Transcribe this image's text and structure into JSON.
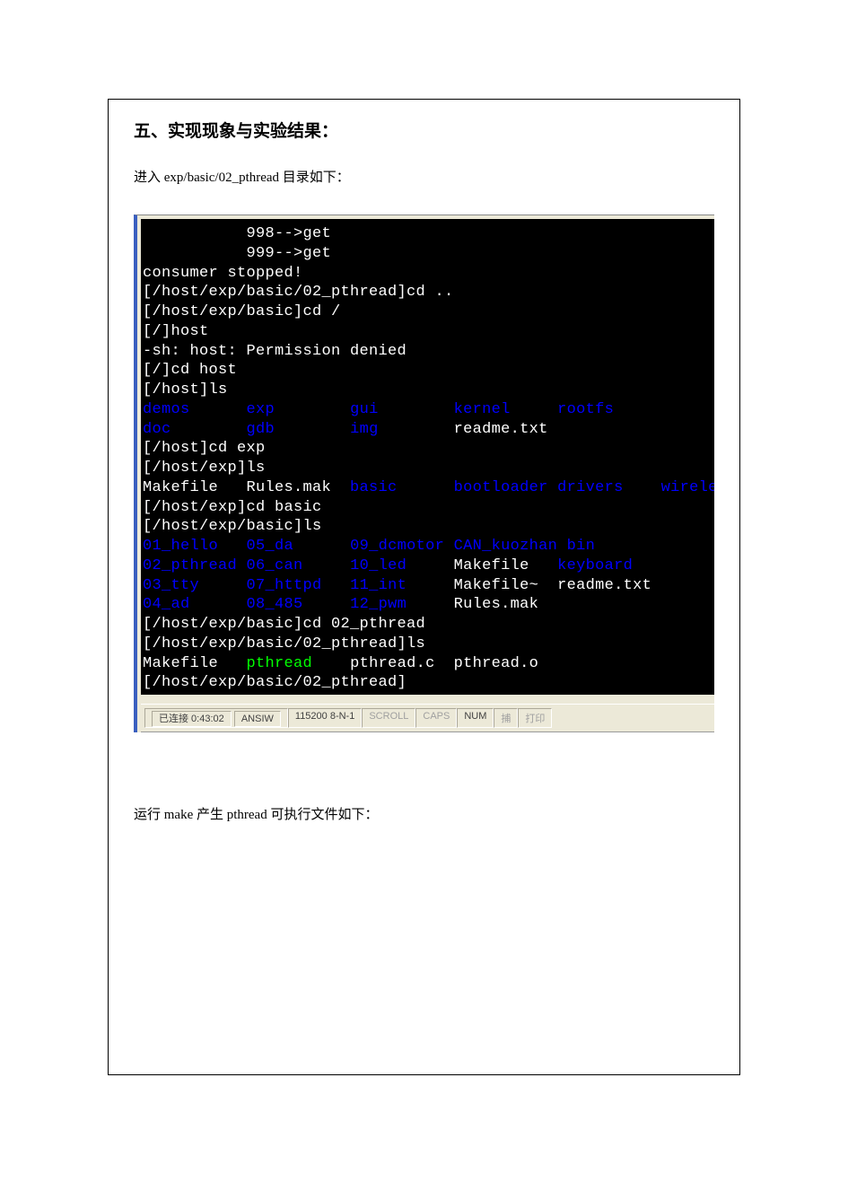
{
  "doc": {
    "heading": "五、实现现象与实验结果：",
    "intro": "进入 exp/basic/02_pthread 目录如下：",
    "post": "运行 make 产生 pthread 可执行文件如下："
  },
  "terminal": {
    "lines": [
      {
        "indent": "           ",
        "segs": [
          {
            "t": "998-->get",
            "c": "w"
          }
        ]
      },
      {
        "indent": "           ",
        "segs": [
          {
            "t": "999-->get",
            "c": "w"
          }
        ]
      },
      {
        "indent": "",
        "segs": [
          {
            "t": "consumer stopped!",
            "c": "w"
          }
        ]
      },
      {
        "indent": "",
        "segs": [
          {
            "t": "[/host/exp/basic/02_pthread]cd ..",
            "c": "w"
          }
        ]
      },
      {
        "indent": "",
        "segs": [
          {
            "t": "[/host/exp/basic]cd /",
            "c": "w"
          }
        ]
      },
      {
        "indent": "",
        "segs": [
          {
            "t": "[/]host",
            "c": "w"
          }
        ]
      },
      {
        "indent": "",
        "segs": [
          {
            "t": "-sh: host: Permission denied",
            "c": "w"
          }
        ]
      },
      {
        "indent": "",
        "segs": [
          {
            "t": "[/]cd host",
            "c": "w"
          }
        ]
      },
      {
        "indent": "",
        "segs": [
          {
            "t": "[/host]ls",
            "c": "w"
          }
        ]
      },
      {
        "indent": "",
        "segs": [
          {
            "t": "demos",
            "c": "b"
          },
          {
            "t": "      ",
            "c": "w"
          },
          {
            "t": "exp",
            "c": "b"
          },
          {
            "t": "        ",
            "c": "w"
          },
          {
            "t": "gui",
            "c": "b"
          },
          {
            "t": "        ",
            "c": "w"
          },
          {
            "t": "kernel",
            "c": "b"
          },
          {
            "t": "     ",
            "c": "w"
          },
          {
            "t": "rootfs",
            "c": "b"
          }
        ]
      },
      {
        "indent": "",
        "segs": [
          {
            "t": "doc",
            "c": "b"
          },
          {
            "t": "        ",
            "c": "w"
          },
          {
            "t": "gdb",
            "c": "b"
          },
          {
            "t": "        ",
            "c": "w"
          },
          {
            "t": "img",
            "c": "b"
          },
          {
            "t": "        ",
            "c": "w"
          },
          {
            "t": "readme.txt",
            "c": "w"
          }
        ]
      },
      {
        "indent": "",
        "segs": [
          {
            "t": "[/host]cd exp",
            "c": "w"
          }
        ]
      },
      {
        "indent": "",
        "segs": [
          {
            "t": "[/host/exp]ls",
            "c": "w"
          }
        ]
      },
      {
        "indent": "",
        "segs": [
          {
            "t": "Makefile   Rules.mak  ",
            "c": "w"
          },
          {
            "t": "basic",
            "c": "b"
          },
          {
            "t": "      ",
            "c": "w"
          },
          {
            "t": "bootloader",
            "c": "b"
          },
          {
            "t": " ",
            "c": "w"
          },
          {
            "t": "drivers",
            "c": "b"
          },
          {
            "t": "    ",
            "c": "w"
          },
          {
            "t": "wireless",
            "c": "b"
          }
        ]
      },
      {
        "indent": "",
        "segs": [
          {
            "t": "[/host/exp]cd basic",
            "c": "w"
          }
        ]
      },
      {
        "indent": "",
        "segs": [
          {
            "t": "[/host/exp/basic]ls",
            "c": "w"
          }
        ]
      },
      {
        "indent": "",
        "segs": [
          {
            "t": "01_hello",
            "c": "b"
          },
          {
            "t": "   ",
            "c": "w"
          },
          {
            "t": "05_da",
            "c": "b"
          },
          {
            "t": "      ",
            "c": "w"
          },
          {
            "t": "09_dcmotor",
            "c": "b"
          },
          {
            "t": " ",
            "c": "w"
          },
          {
            "t": "CAN_kuozhan",
            "c": "b"
          },
          {
            "t": " ",
            "c": "w"
          },
          {
            "t": "bin",
            "c": "b"
          }
        ]
      },
      {
        "indent": "",
        "segs": [
          {
            "t": "02_pthread",
            "c": "b"
          },
          {
            "t": " ",
            "c": "w"
          },
          {
            "t": "06_can",
            "c": "b"
          },
          {
            "t": "     ",
            "c": "w"
          },
          {
            "t": "10_led",
            "c": "b"
          },
          {
            "t": "     ",
            "c": "w"
          },
          {
            "t": "Makefile   ",
            "c": "w"
          },
          {
            "t": "keyboard",
            "c": "b"
          }
        ]
      },
      {
        "indent": "",
        "segs": [
          {
            "t": "03_tty",
            "c": "b"
          },
          {
            "t": "     ",
            "c": "w"
          },
          {
            "t": "07_httpd",
            "c": "b"
          },
          {
            "t": "   ",
            "c": "w"
          },
          {
            "t": "11_int",
            "c": "b"
          },
          {
            "t": "     ",
            "c": "w"
          },
          {
            "t": "Makefile~  readme.txt",
            "c": "w"
          }
        ]
      },
      {
        "indent": "",
        "segs": [
          {
            "t": "04_ad",
            "c": "b"
          },
          {
            "t": "      ",
            "c": "w"
          },
          {
            "t": "08_485",
            "c": "b"
          },
          {
            "t": "     ",
            "c": "w"
          },
          {
            "t": "12_pwm",
            "c": "b"
          },
          {
            "t": "     ",
            "c": "w"
          },
          {
            "t": "Rules.mak",
            "c": "w"
          }
        ]
      },
      {
        "indent": "",
        "segs": [
          {
            "t": "[/host/exp/basic]cd 02_pthread",
            "c": "w"
          }
        ]
      },
      {
        "indent": "",
        "segs": [
          {
            "t": "[/host/exp/basic/02_pthread]ls",
            "c": "w"
          }
        ]
      },
      {
        "indent": "",
        "segs": [
          {
            "t": "Makefile   ",
            "c": "w"
          },
          {
            "t": "pthread",
            "c": "g"
          },
          {
            "t": "    ",
            "c": "w"
          },
          {
            "t": "pthread.c  pthread.o",
            "c": "w"
          }
        ]
      },
      {
        "indent": "",
        "segs": [
          {
            "t": "[/host/exp/basic/02_pthread]",
            "c": "w"
          }
        ]
      }
    ]
  },
  "status": {
    "conn": "已连接 0:43:02",
    "emul": "ANSIW",
    "serial": "115200 8-N-1",
    "indicators": [
      "SCROLL",
      "CAPS",
      "NUM",
      "捕",
      "打印"
    ]
  }
}
